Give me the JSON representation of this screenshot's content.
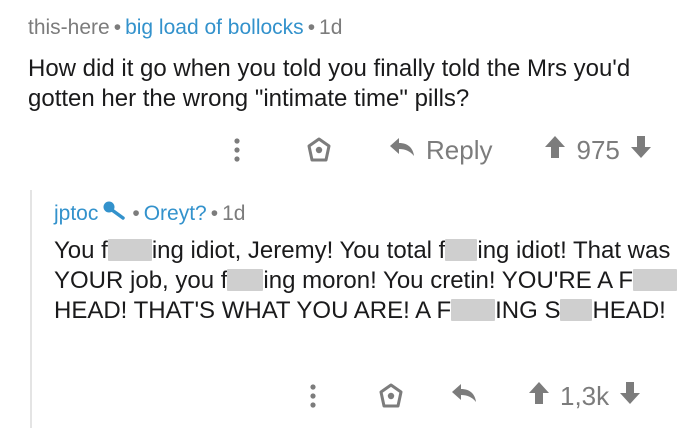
{
  "top_comment": {
    "username": "this-here",
    "flair": "big load of bollocks",
    "age": "1d",
    "text": "How did it go when you told you finally told the Mrs you'd gotten her the wrong \"intimate time\" pills?",
    "reply_label": "Reply",
    "score": "975"
  },
  "reply_comment": {
    "username": "jptoc",
    "flair": "Oreyt?",
    "age": "1d",
    "segments": [
      "You f",
      "ing idiot, Jeremy! You total f",
      "ing idiot! That was YOUR job, you f",
      "ing moron! You cretin! YOU'RE A F",
      "HEAD! THAT'S WHAT YOU ARE! A F",
      "ING S",
      "HEAD!"
    ],
    "score": "1,3k"
  },
  "colors": {
    "link": "#3392cc",
    "muted": "#7c7c7c",
    "text": "#1a1a1b",
    "thread_line": "#e4e4e4"
  },
  "icons": [
    "more-options-icon",
    "award-shield-icon",
    "reply-arrow-icon",
    "upvote-arrow-icon",
    "downvote-arrow-icon",
    "pencil-mic-icon"
  ]
}
